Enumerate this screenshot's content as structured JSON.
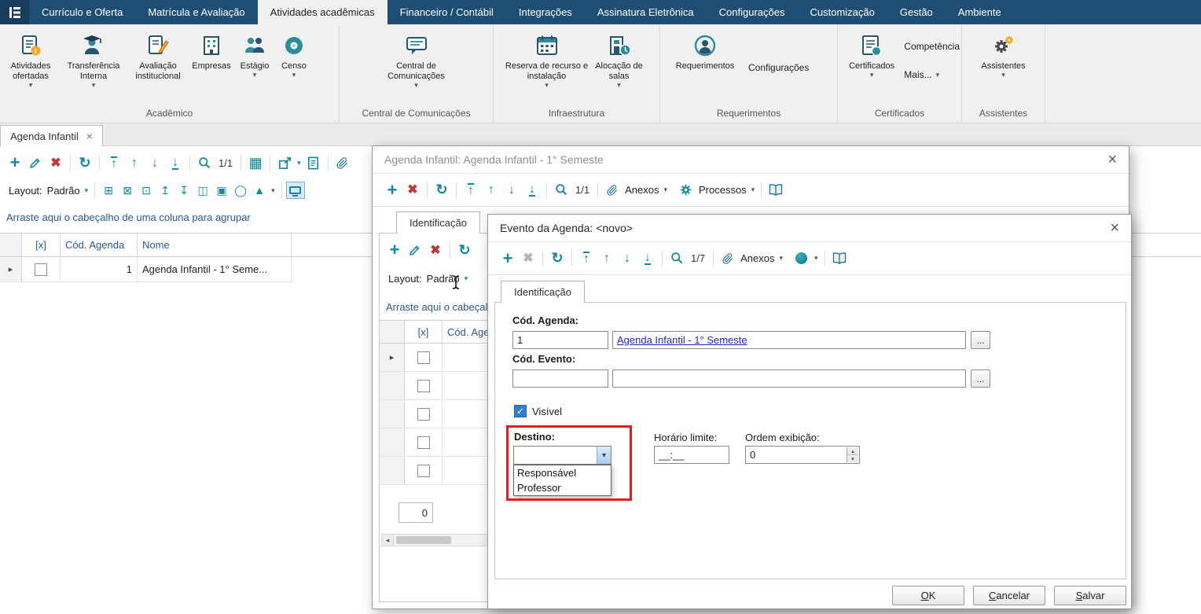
{
  "icons": {
    "plus": "+",
    "delete": "✖",
    "refresh": "↻",
    "arrow_up": "↑",
    "arrow_down": "↓",
    "caret_down": "▾",
    "caret_up": "▴",
    "caret_left": "◂",
    "close": "×",
    "columns": "▦",
    "row_marker": "▸",
    "check": "✓",
    "panel_add": "⊞",
    "panel_close": "⊠",
    "panel_dock": "⊡",
    "dock_top": "↥",
    "dock_bottom": "↧",
    "split": "◫",
    "pin": "▣",
    "ellipse": "◯",
    "chart": "▲"
  },
  "menubar": {
    "items": [
      {
        "label": "Currículo e Oferta"
      },
      {
        "label": "Matrícula e Avaliação"
      },
      {
        "label": "Atividades acadêmicas"
      },
      {
        "label": "Financeiro / Contábil"
      },
      {
        "label": "Integrações"
      },
      {
        "label": "Assinatura Eletrônica"
      },
      {
        "label": "Configurações"
      },
      {
        "label": "Customização"
      },
      {
        "label": "Gestão"
      },
      {
        "label": "Ambiente"
      }
    ]
  },
  "ribbon": {
    "academico": {
      "label": "Acadêmico",
      "atividades_ofertadas": "Atividades ofertadas",
      "transferencia_interna": "Transferência Interna",
      "avaliacao_institucional": "Avaliação institucional",
      "empresas": "Empresas",
      "estagio": "Estágio",
      "censo": "Censo"
    },
    "central": {
      "label": "Central de Comunicações",
      "central_de_comunicacoes": "Central de Comunicações"
    },
    "infraestrutura": {
      "label": "Infraestrutura",
      "reserva": "Reserva de recurso e instalação",
      "alocacao": "Alocação de salas"
    },
    "requerimentos": {
      "label": "Requerimentos",
      "requerimentos": "Requerimentos",
      "configuracoes": "Configurações"
    },
    "certificados": {
      "label": "Certificados",
      "certificados": "Certificados",
      "competencia": "Competência",
      "mais": "Mais..."
    },
    "assistentes": {
      "label": "Assistentes",
      "assistentes": "Assistentes"
    }
  },
  "workspace": {
    "tab": {
      "label": "Agenda Infantil"
    },
    "toolbar": {
      "position": "1/1"
    },
    "layout_bar": {
      "label": "Layout:",
      "value": "Padrão"
    },
    "group_hint": "Arraste aqui o cabeçalho de uma coluna para agrupar",
    "grid": {
      "col_marker": "[x]",
      "col_cod": "Cód. Agenda",
      "col_nome": "Nome",
      "rows": [
        {
          "cod": "1",
          "nome": "Agenda Infantil - 1° Seme..."
        }
      ]
    }
  },
  "dialog_agenda": {
    "title": "Agenda Infantil: Agenda Infantil - 1° Semeste",
    "toolbar": {
      "position": "1/1",
      "anexos": "Anexos",
      "processos": "Processos"
    },
    "tab": "Identificação",
    "layout_bar": {
      "label": "Layout:",
      "value": "Padrão"
    },
    "group_hint": "Arraste aqui o cabeçalho de uma coluna para agrupar",
    "grid": {
      "col_marker": "[x]",
      "col_cod": "Cód. Agenda",
      "count": "0"
    }
  },
  "dialog_evento": {
    "title": "Evento da Agenda: <novo>",
    "toolbar": {
      "position": "1/7",
      "anexos": "Anexos"
    },
    "tab": "Identificação",
    "fields": {
      "cod_agenda_label": "Cód. Agenda:",
      "cod_agenda_value": "1",
      "cod_agenda_desc": "Agenda Infantil - 1° Semeste",
      "lookup_button": "...",
      "cod_evento_label": "Cód. Evento:",
      "cod_evento_value": "",
      "cod_evento_desc": "",
      "visivel_label": "Visível",
      "destino_label": "Destino:",
      "destino_value": "",
      "destino_options": [
        "Responsável",
        "Professor"
      ],
      "horario_label": "Horário limite:",
      "horario_value": "__:__",
      "ordem_label": "Ordem exibição:",
      "ordem_value": "0"
    },
    "buttons": {
      "ok": {
        "accel": "O",
        "rest": "K"
      },
      "cancelar": {
        "accel": "C",
        "rest": "ancelar"
      },
      "salvar": {
        "accel": "S",
        "rest": "alvar"
      }
    }
  }
}
